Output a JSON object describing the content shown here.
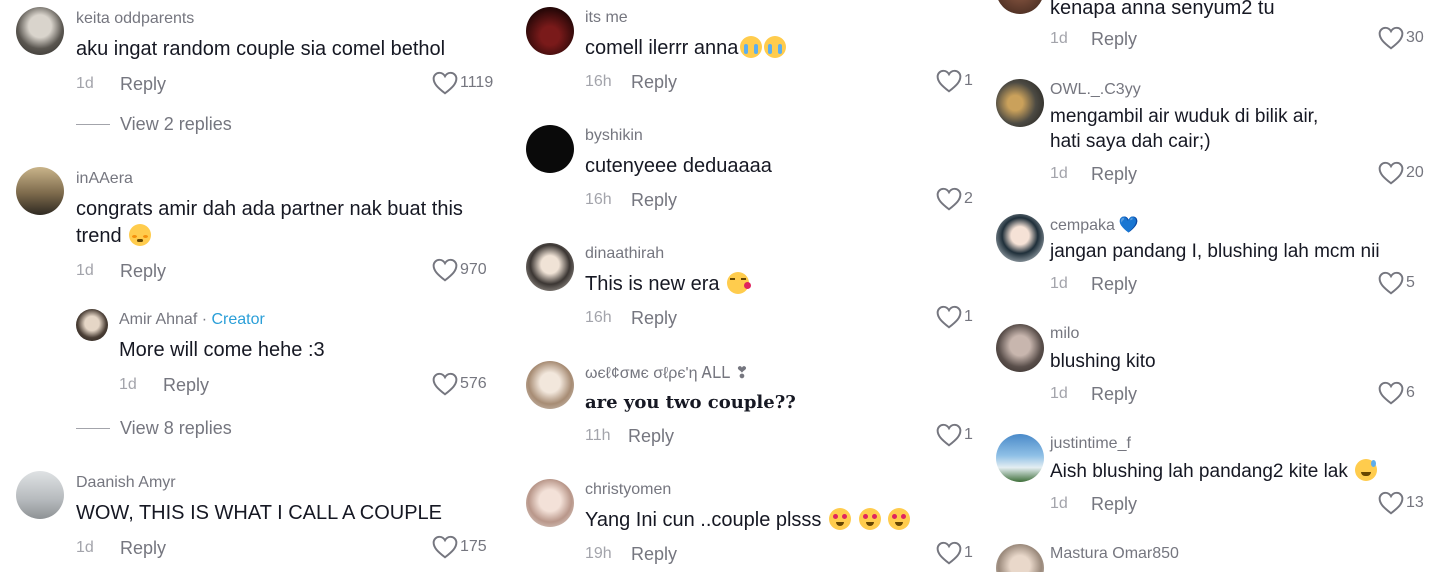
{
  "colors": {
    "text": "#161823",
    "secondary": "#75767f",
    "muted": "#a3a4ab",
    "creator": "#2b9fd8"
  },
  "col1": {
    "c1": {
      "username": "keita oddparents",
      "text": "aku ingat random couple sia comel bethol",
      "time": "1d",
      "reply": "Reply",
      "likes": "1119"
    },
    "c1_view": "View 2 replies",
    "c2": {
      "username": "inAAera",
      "text_line1": "congrats amir dah ada partner nak buat this",
      "text_line2": "trend",
      "time": "1d",
      "reply": "Reply",
      "likes": "970"
    },
    "r1": {
      "username": "Amir Ahnaf",
      "creator_sep": "·",
      "creator": "Creator",
      "text": "More will come hehe :3",
      "time": "1d",
      "reply": "Reply",
      "likes": "576"
    },
    "c2_view": "View 8 replies",
    "c3": {
      "username": "Daanish Amyr",
      "text": "WOW, THIS IS WHAT I CALL A COUPLE",
      "time": "1d",
      "reply": "Reply",
      "likes": "175"
    }
  },
  "col2": {
    "c1": {
      "username": "its me",
      "text": "comell ilerrr anna",
      "time": "16h",
      "reply": "Reply",
      "likes": "1"
    },
    "c2": {
      "username": "byshikin",
      "text": "cutenyeee deduaaaa",
      "time": "16h",
      "reply": "Reply",
      "likes": "2"
    },
    "c3": {
      "username": "dinaathirah",
      "text": "This is new era",
      "time": "16h",
      "reply": "Reply",
      "likes": "1"
    },
    "c4": {
      "username": "ωєℓ¢σмє σℓρє'η ᎪᏞᏞ ❣",
      "text": "are you two couple??",
      "time": "11h",
      "reply": "Reply",
      "likes": "1"
    },
    "c5": {
      "username": "christyomen",
      "text": "Yang Ini cun ..couple plsss",
      "time": "19h",
      "reply": "Reply",
      "likes": "1"
    }
  },
  "col3": {
    "c0": {
      "text": "kenapa anna senyum2 tu",
      "time": "1d",
      "reply": "Reply",
      "likes": "30"
    },
    "c1": {
      "username": "OWL._.C3yy",
      "text_line1": "mengambil air wuduk di bilik air,",
      "text_line2": "hati saya dah cair;)",
      "time": "1d",
      "reply": "Reply",
      "likes": "20"
    },
    "c2": {
      "username": "cempaka",
      "username_emoji": "💙",
      "text": "jangan pandang I, blushing lah mcm nii",
      "time": "1d",
      "reply": "Reply",
      "likes": "5"
    },
    "c3": {
      "username": "milo",
      "text": "blushing kito",
      "time": "1d",
      "reply": "Reply",
      "likes": "6"
    },
    "c4": {
      "username": "justintime_f",
      "text": "Aish blushing lah pandang2 kite lak",
      "time": "1d",
      "reply": "Reply",
      "likes": "13"
    },
    "c5": {
      "username": "Mastura Omar850"
    }
  }
}
